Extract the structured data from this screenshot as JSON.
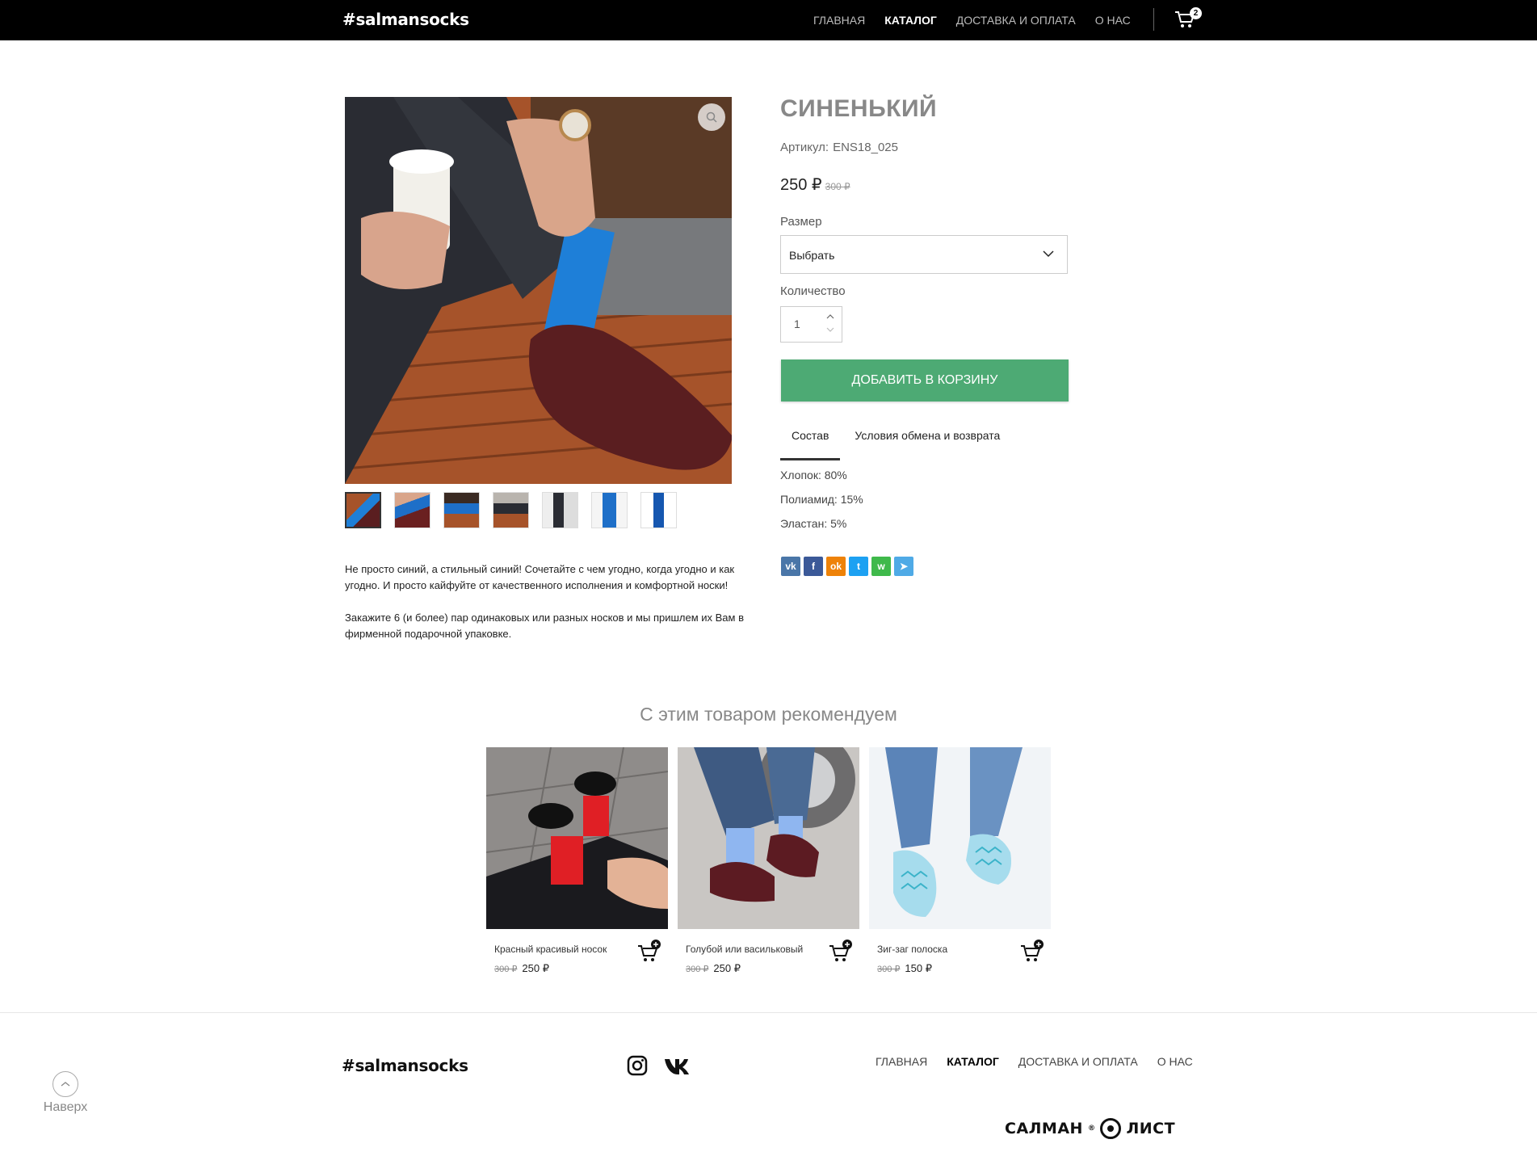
{
  "header": {
    "logo": "#salmansocks",
    "nav": [
      {
        "label": "ГЛАВНАЯ",
        "active": false
      },
      {
        "label": "КАТАЛОГ",
        "active": true
      },
      {
        "label": "ДОСТАВКА И ОПЛАТА",
        "active": false
      },
      {
        "label": "О НАС",
        "active": false
      }
    ],
    "cart_count": "2",
    "cart_icon": "cart-icon"
  },
  "product": {
    "title": "СИНЕНЬКИЙ",
    "sku_label": "Артикул:",
    "sku": "ENS18_025",
    "price": "250 ₽",
    "old_price": "300 ₽",
    "size_label": "Размер",
    "size_value": "Выбрать",
    "qty_label": "Количество",
    "qty_value": "1",
    "add_to_cart": "ДОБАВИТЬ В КОРЗИНУ",
    "tabs": [
      "Состав",
      "Условия обмена и возврата"
    ],
    "composition": [
      "Хлопок: 80%",
      "Полиамид: 15%",
      "Эластан: 5%"
    ],
    "description": [
      "Не просто синий, а стильный синий! Сочетайте с чем угодно, когда угодно и как угодно. И просто кайфуйте от качественного исполнения и комфортной носки!",
      "Закажите 6 (и более) пар одинаковых или разных носков и мы пришлем их Вам в фирменной подарочной упаковке."
    ],
    "thumbnail_count": 7
  },
  "social": [
    {
      "icon": "vk-icon",
      "glyph": "vk",
      "color": "#4a76a8"
    },
    {
      "icon": "facebook-icon",
      "glyph": "f",
      "color": "#3b5998"
    },
    {
      "icon": "odnoklassniki-icon",
      "glyph": "ok",
      "color": "#ee8208"
    },
    {
      "icon": "twitter-icon",
      "glyph": "t",
      "color": "#1da1f2"
    },
    {
      "icon": "whatsapp-icon",
      "glyph": "w",
      "color": "#3fb94b"
    },
    {
      "icon": "telegram-icon",
      "glyph": "➤",
      "color": "#4faae6"
    }
  ],
  "recommended": {
    "title": "С этим товаром рекомендуем",
    "items": [
      {
        "name": "Красный красивый носок",
        "old_price": "300 ₽",
        "price": "250 ₽"
      },
      {
        "name": "Голубой или васильковый",
        "old_price": "300 ₽",
        "price": "250 ₽"
      },
      {
        "name": "Зиг-заг полоска",
        "old_price": "300 ₽",
        "price": "150 ₽"
      }
    ]
  },
  "footer": {
    "logo": "#salmansocks",
    "nav": [
      {
        "label": "ГЛАВНАЯ",
        "active": false
      },
      {
        "label": "КАТАЛОГ",
        "active": true
      },
      {
        "label": "ДОСТАВКА И ОПЛАТА",
        "active": false
      },
      {
        "label": "О НАС",
        "active": false
      }
    ],
    "back_to_top": "Наверх",
    "brand_left": "САЛМАН",
    "brand_right": "ЛИСТ"
  },
  "colors": {
    "accent_green": "#4daa74",
    "header_bg": "#000000"
  }
}
